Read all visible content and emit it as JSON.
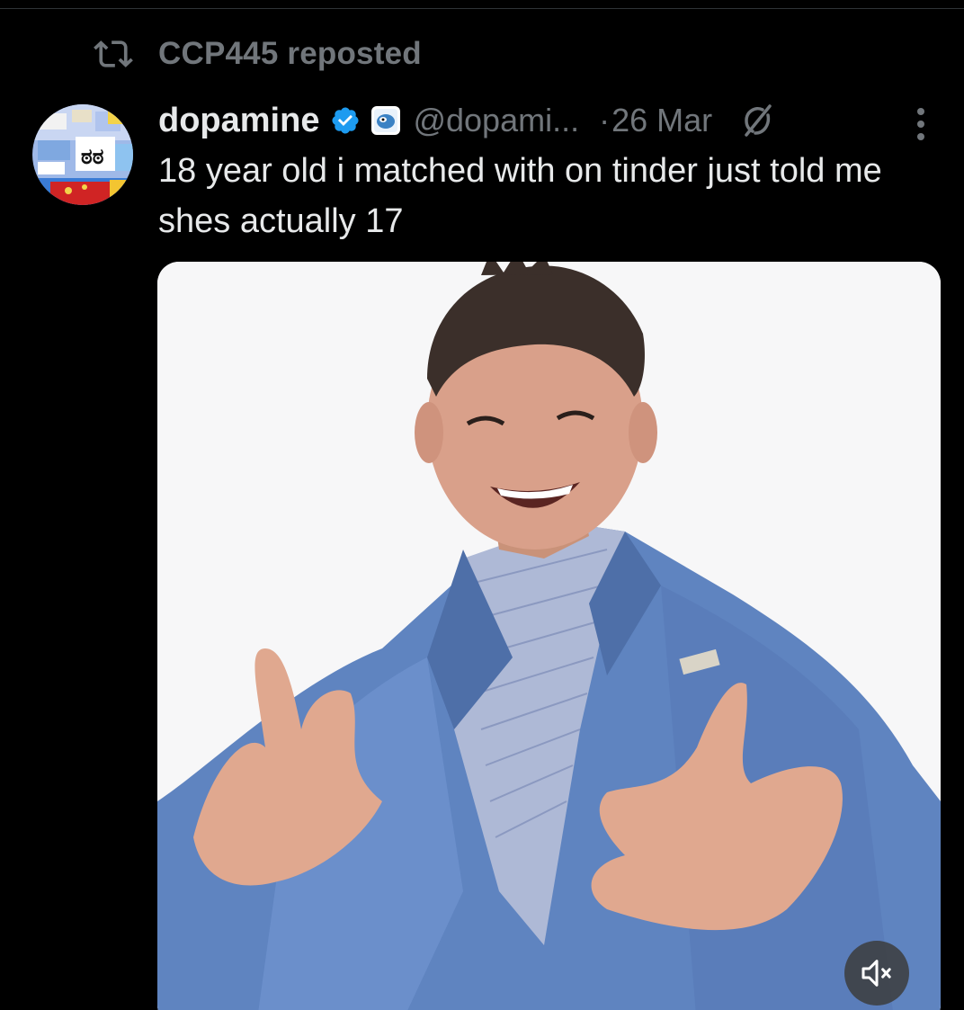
{
  "repost": {
    "icon": "repost-icon",
    "text": "CCP445 reposted"
  },
  "post": {
    "author": {
      "display_name": "dopamine",
      "handle": "@dopami...",
      "verified_icon": "verified-badge-icon",
      "affiliate_icon": "affiliate-badge-icon"
    },
    "separator": "·",
    "timestamp": "26 Mar",
    "text": "18 year old i matched with on tinder just told me shes actually 17",
    "media": {
      "type": "video",
      "mute_icon": "volume-muted-icon"
    }
  },
  "colors": {
    "background": "#000000",
    "text_primary": "#e7e9ea",
    "text_secondary": "#71767b",
    "verified_blue": "#1d9bf0"
  }
}
